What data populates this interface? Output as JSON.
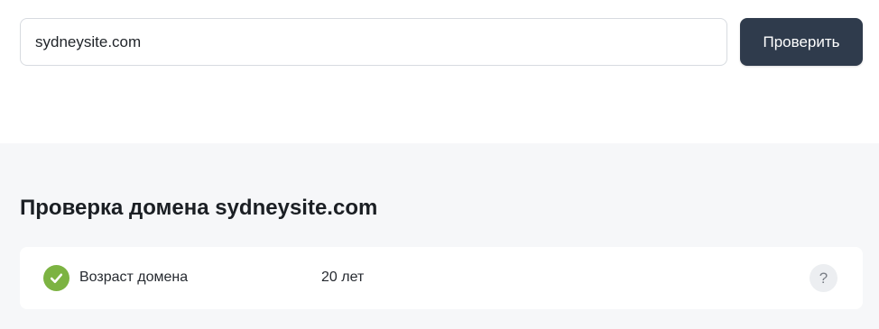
{
  "search": {
    "value": "sydneysite.com",
    "button_label": "Проверить"
  },
  "results": {
    "title": "Проверка домена sydneysite.com",
    "items": [
      {
        "label": "Возраст домена",
        "value": "20 лет",
        "status": "ok",
        "status_icon": "check-circle-icon",
        "help_glyph": "?"
      }
    ]
  },
  "colors": {
    "button_bg": "#2f3b4c",
    "status_ok": "#7cb342",
    "section_bg": "#f6f7f9"
  }
}
